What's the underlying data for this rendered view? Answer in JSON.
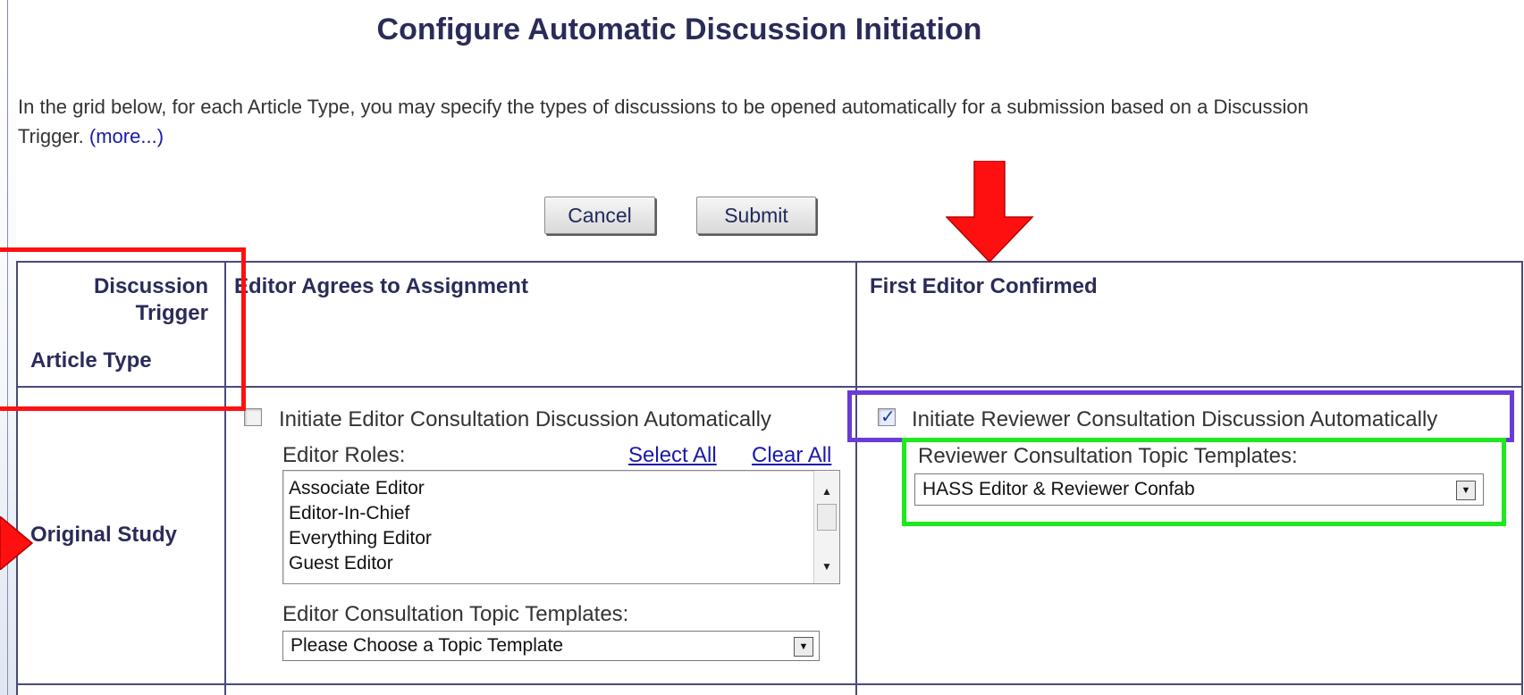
{
  "page": {
    "title": "Configure Automatic Discussion Initiation",
    "intro_text": "In the grid below, for each Article Type, you may specify the types of discussions to be opened automatically for a submission based on a Discussion Trigger.",
    "more_link": "(more...)"
  },
  "buttons": {
    "cancel": "Cancel",
    "submit": "Submit"
  },
  "grid": {
    "header": {
      "trigger_label_1": "Discussion",
      "trigger_label_2": "Trigger",
      "article_type_label": "Article Type",
      "col1": "Editor Agrees to Assignment",
      "col2": "First Editor Confirmed"
    },
    "row": {
      "article_type": "Original Study",
      "editor_section": {
        "checkbox_label": "Initiate Editor Consultation Discussion Automatically",
        "checked": false,
        "roles_label": "Editor Roles:",
        "select_all": "Select All",
        "clear_all": "Clear All",
        "roles": [
          "Associate Editor",
          "Editor-In-Chief",
          "Everything Editor",
          "Guest Editor"
        ],
        "topic_label": "Editor Consultation Topic Templates:",
        "topic_value": "Please Choose a Topic Template"
      },
      "reviewer_section": {
        "checkbox_label": "Initiate Reviewer Consultation Discussion Automatically",
        "checked": true,
        "topic_label": "Reviewer Consultation Topic Templates:",
        "topic_value": "HASS Editor & Reviewer Confab"
      }
    }
  },
  "annotations": {
    "red": "#ff1010",
    "purple": "#6a3bd8",
    "green": "#1ee81e"
  },
  "icons": {
    "checkmark": "✓",
    "dropdown": "▼",
    "scroll_up": "▲",
    "scroll_down": "▼"
  }
}
